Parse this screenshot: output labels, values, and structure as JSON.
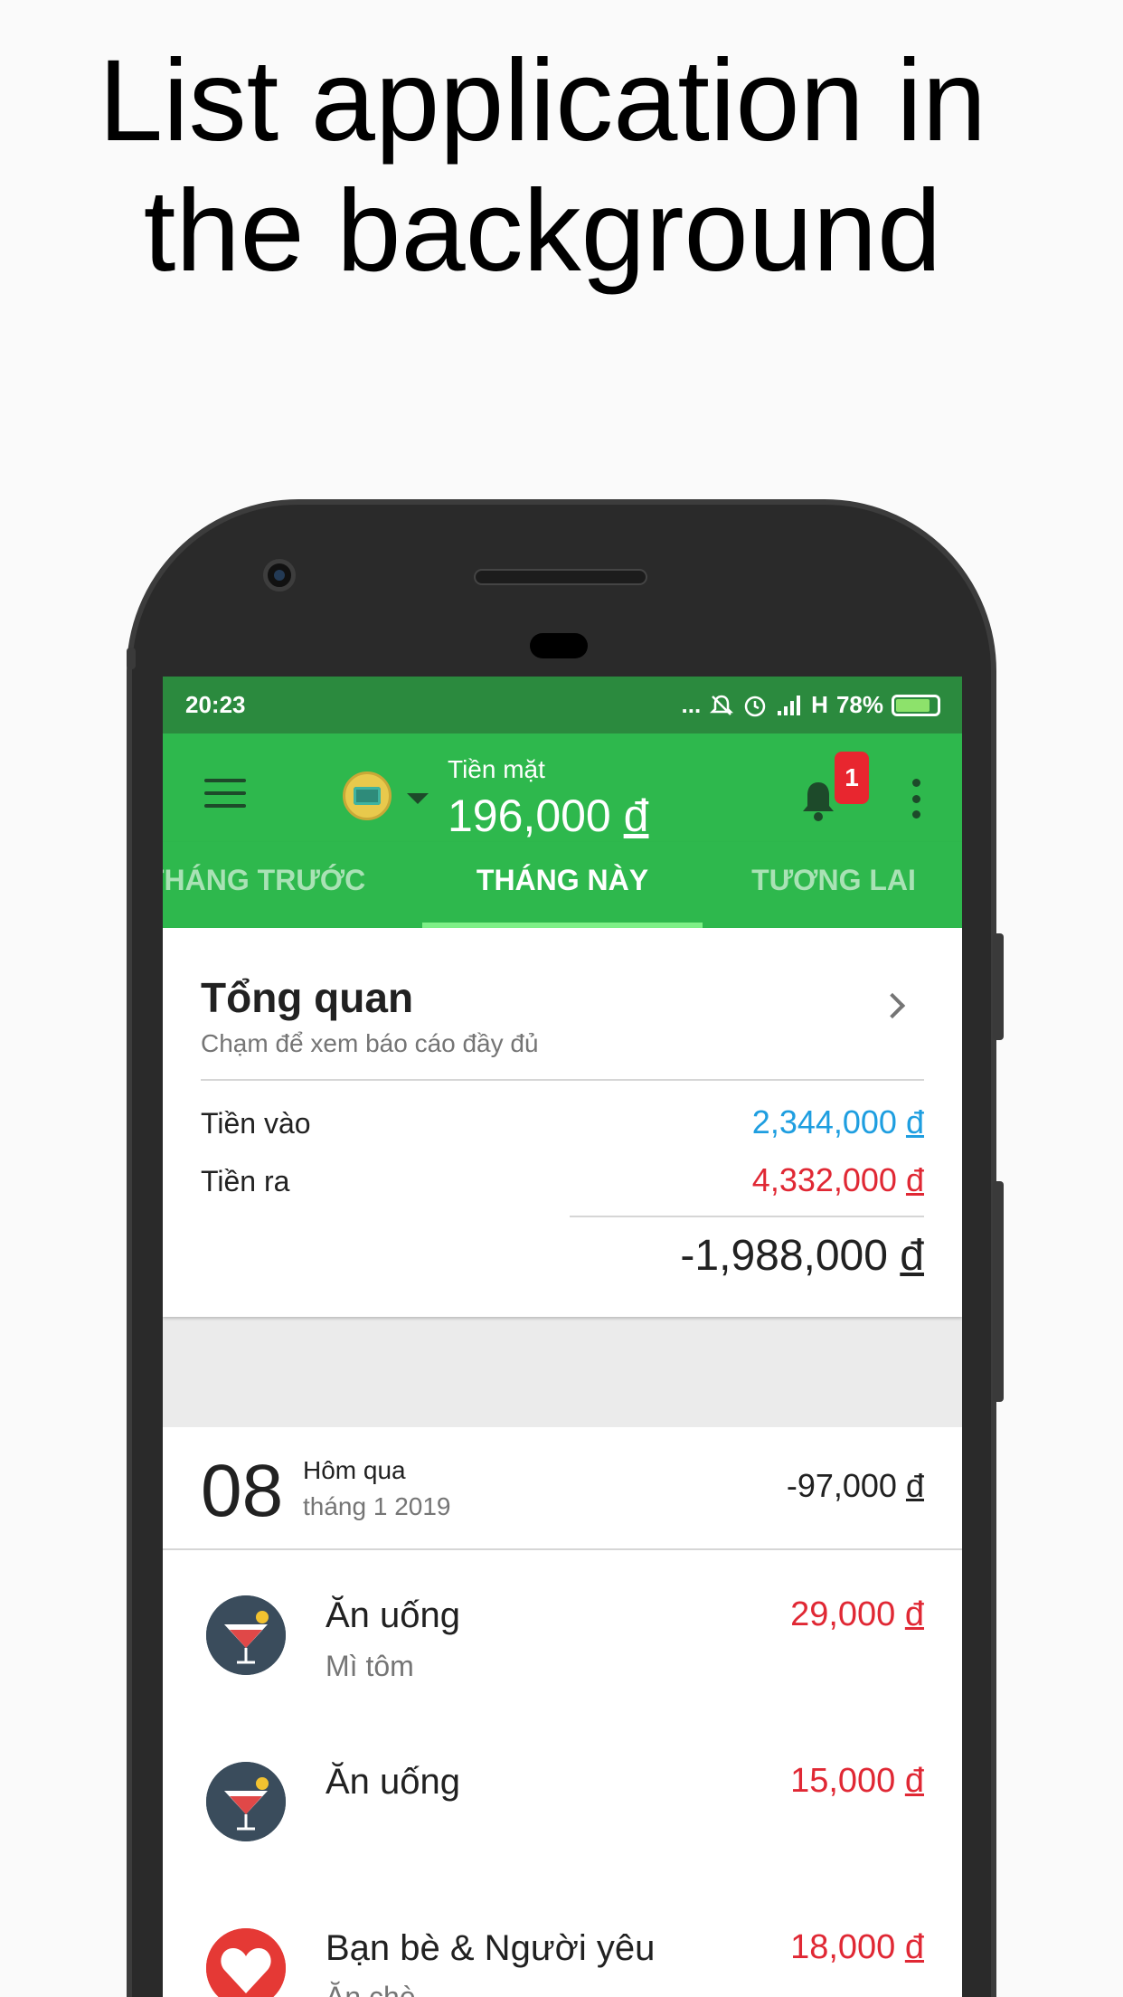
{
  "headline": {
    "line1": "List application in",
    "line2": "the background"
  },
  "status_bar": {
    "time": "20:23",
    "dots": "...",
    "network": "H",
    "battery": "78%",
    "battery_level": 0.78
  },
  "app_bar": {
    "wallet_name": "Tiền mặt",
    "wallet_balance": "196,000",
    "currency": "đ",
    "notification_count": "1"
  },
  "tabs": [
    {
      "label": "THÁNG TRƯỚC",
      "active": false
    },
    {
      "label": "THÁNG NÀY",
      "active": true
    },
    {
      "label": "TƯƠNG LAI",
      "active": false
    }
  ],
  "overview": {
    "title": "Tổng quan",
    "subtitle": "Chạm để xem báo cáo đầy đủ",
    "inflow_label": "Tiền vào",
    "inflow_value": "2,344,000",
    "outflow_label": "Tiền ra",
    "outflow_value": "4,332,000",
    "net_value": "-1,988,000",
    "currency": "đ"
  },
  "day_group": {
    "day": "08",
    "relative": "Hôm qua",
    "month_year": "tháng 1 2019",
    "total": "-97,000",
    "currency": "đ"
  },
  "transactions": [
    {
      "category": "Ăn uống",
      "note": "Mì tôm",
      "amount": "29,000",
      "currency": "đ",
      "icon": "cocktail-icon"
    },
    {
      "category": "Ăn uống",
      "note": "",
      "amount": "15,000",
      "currency": "đ",
      "icon": "cocktail-icon"
    },
    {
      "category": "Bạn bè & Người yêu",
      "note": "Ăn chè",
      "amount": "18,000",
      "currency": "đ",
      "icon": "heart-icon"
    }
  ],
  "colors": {
    "primary": "#2eb84d",
    "status_bar": "#2b8a3e",
    "inflow": "#1e9ee0",
    "outflow": "#e02834",
    "badge": "#e8262f"
  }
}
